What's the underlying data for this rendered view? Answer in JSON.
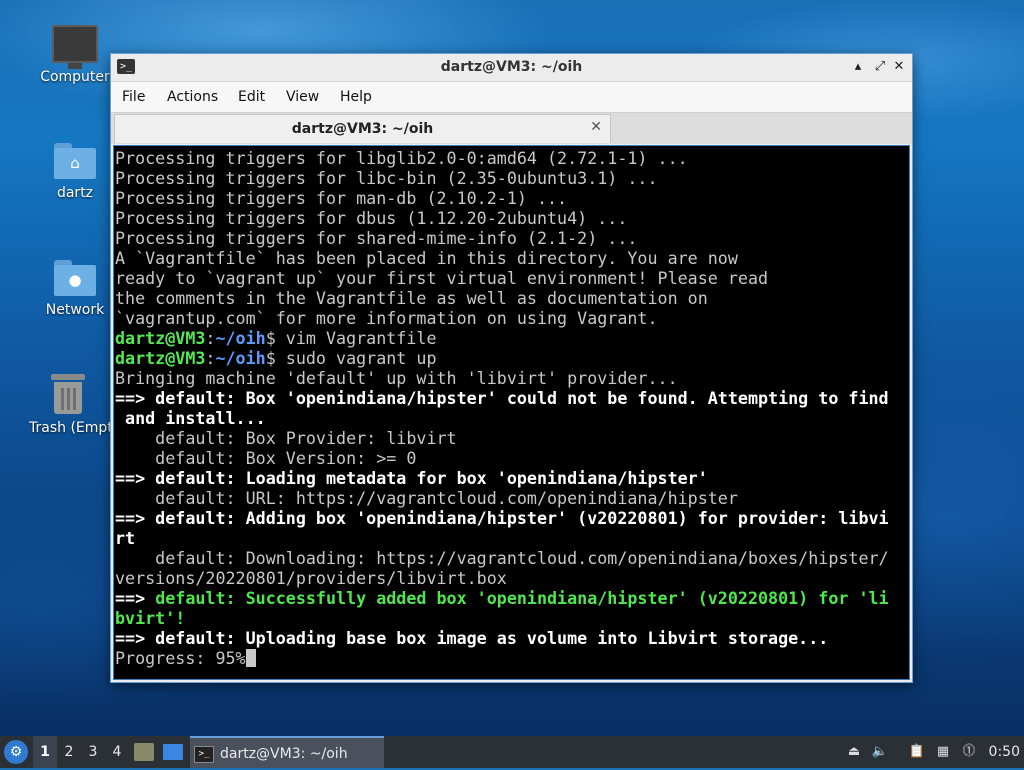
{
  "desktop": {
    "icons": [
      {
        "label": "Computer"
      },
      {
        "label": "dartz"
      },
      {
        "label": "Network"
      },
      {
        "label": "Trash (Empty)"
      }
    ]
  },
  "window": {
    "title": "dartz@VM3: ~/oih",
    "menu": [
      "File",
      "Actions",
      "Edit",
      "View",
      "Help"
    ],
    "tab_title": "dartz@VM3: ~/oih",
    "controls": {
      "minimize": "▴",
      "maximize": "⤢",
      "close": "✕"
    }
  },
  "terminal": {
    "prompt_user": "dartz@VM3",
    "prompt_sep": ":",
    "prompt_path": "~/oih",
    "prompt_symbol": "$",
    "lines": [
      "Processing triggers for libglib2.0-0:amd64 (2.72.1-1) ...",
      "Processing triggers for libc-bin (2.35-0ubuntu3.1) ...",
      "Processing triggers for man-db (2.10.2-1) ...",
      "Processing triggers for dbus (1.12.20-2ubuntu4) ...",
      "Processing triggers for shared-mime-info (2.1-2) ...",
      "A `Vagrantfile` has been placed in this directory. You are now",
      "ready to `vagrant up` your first virtual environment! Please read",
      "the comments in the Vagrantfile as well as documentation on",
      "`vagrantup.com` for more information on using Vagrant.",
      " vim Vagrantfile",
      " sudo vagrant up",
      "Bringing machine 'default' up with 'libvirt' provider...",
      "==> default: Box 'openindiana/hipster' could not be found. Attempting to find",
      " and install...",
      "    default: Box Provider: libvirt",
      "    default: Box Version: >= 0",
      "==> default: Loading metadata for box 'openindiana/hipster'",
      "    default: URL: https://vagrantcloud.com/openindiana/hipster",
      "==> default: Adding box 'openindiana/hipster' (v20220801) for provider: libvi",
      "rt",
      "    default: Downloading: https://vagrantcloud.com/openindiana/boxes/hipster/",
      "versions/20220801/providers/libvirt.box",
      "==> default: Successfully added box 'openindiana/hipster' (v20220801) for 'li",
      "bvirt'!",
      "==> default: Uploading base box image as volume into Libvirt storage...",
      "Progress: 95%"
    ]
  },
  "taskbar": {
    "start_icon": "start-menu-icon",
    "workspaces": [
      "1",
      "2",
      "3",
      "4"
    ],
    "active_workspace": "1",
    "task_title": "dartz@VM3: ~/oih",
    "clock": "0:50",
    "tray_icons": [
      "eject-icon",
      "volume-icon",
      "clipboard-icon",
      "network-icon",
      "notification-icon"
    ]
  },
  "colors": {
    "prompt_green": "#55e855",
    "path_blue": "#5d9cff",
    "success_green": "#4ee84e",
    "terminal_bg": "#000000",
    "taskbar_bg": "#2b2f36"
  }
}
